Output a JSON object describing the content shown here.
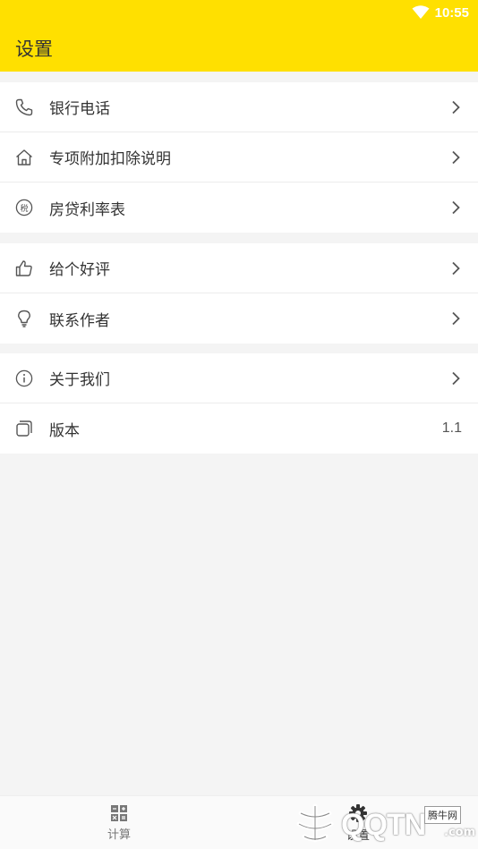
{
  "status_bar": {
    "time": "10:55"
  },
  "app_bar": {
    "title": "设置"
  },
  "groups": [
    {
      "items": [
        {
          "label": "银行电话",
          "icon": "phone-icon"
        },
        {
          "label": "专项附加扣除说明",
          "icon": "home-icon"
        },
        {
          "label": "房贷利率表",
          "icon": "tax-icon",
          "icon_text": "税"
        }
      ]
    },
    {
      "items": [
        {
          "label": "给个好评",
          "icon": "thumbs-up-icon"
        },
        {
          "label": "联系作者",
          "icon": "lightbulb-icon"
        }
      ]
    },
    {
      "items": [
        {
          "label": "关于我们",
          "icon": "info-icon"
        },
        {
          "label": "版本",
          "icon": "copy-icon",
          "value": "1.1"
        }
      ]
    }
  ],
  "bottom_nav": {
    "items": [
      {
        "label": "计算",
        "icon": "calculator-grid-icon"
      },
      {
        "label": "设置",
        "icon": "gear-icon"
      }
    ]
  },
  "watermark": {
    "text": "QQTN",
    "badge": "腾牛网",
    "suffix": ".com"
  },
  "colors": {
    "accent": "#ffe000",
    "background": "#f4f4f4"
  }
}
